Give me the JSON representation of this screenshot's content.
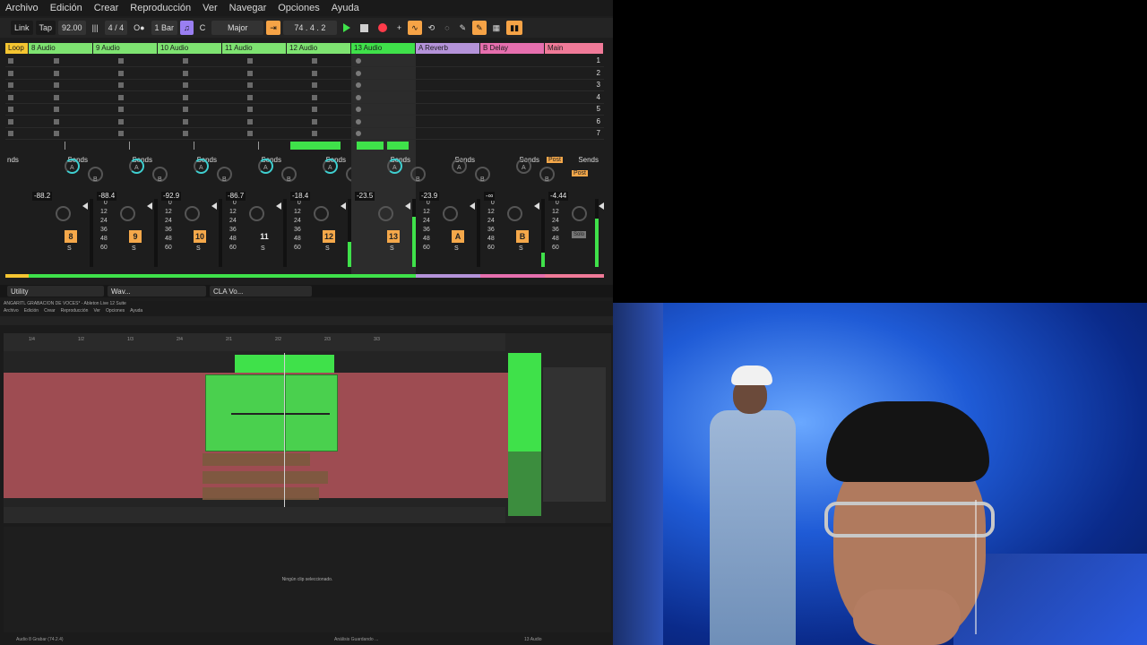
{
  "menu": [
    "Archivo",
    "Edición",
    "Crear",
    "Reproducción",
    "Ver",
    "Navegar",
    "Opciones",
    "Ayuda"
  ],
  "transport": {
    "link": "Link",
    "tap": "Tap",
    "tempo": "92.00",
    "signature": "4 / 4",
    "quantize": "1 Bar",
    "key": "C",
    "scale": "Major",
    "position": "74 .  4 .  2"
  },
  "tracks": [
    {
      "name": "Loop",
      "color": "#f5c531",
      "num": "",
      "vol": "",
      "numStyle": ""
    },
    {
      "name": "8 Audio",
      "color": "#7ee371",
      "num": "8",
      "vol": "-88.2",
      "numStyle": "orange"
    },
    {
      "name": "9 Audio",
      "color": "#7ee371",
      "num": "9",
      "vol": "-88.4",
      "numStyle": "orange"
    },
    {
      "name": "10 Audio",
      "color": "#7ee371",
      "num": "10",
      "vol": "-92.9",
      "numStyle": "orange"
    },
    {
      "name": "11 Audio",
      "color": "#7ee371",
      "num": "11",
      "vol": "-86.7",
      "numStyle": "plain"
    },
    {
      "name": "12 Audio",
      "color": "#7ee371",
      "num": "12",
      "vol": "-18.4",
      "numStyle": "orange"
    },
    {
      "name": "13 Audio",
      "color": "#3fe14a",
      "num": "13",
      "vol": "-23.5",
      "numStyle": "orange"
    },
    {
      "name": "A Reverb",
      "color": "#b493d9",
      "num": "A",
      "vol": "-23.9",
      "numStyle": "orange"
    },
    {
      "name": "B Delay",
      "color": "#e66fae",
      "num": "B",
      "vol": "-∞",
      "numStyle": "orange"
    },
    {
      "name": "Main",
      "color": "#f07a98",
      "num": "",
      "vol": "-4.44",
      "numStyle": ""
    }
  ],
  "sends_label": "Sends",
  "send_a": "A",
  "send_b": "B",
  "sends_partial": "nds",
  "s_button": "S",
  "post_label": "Post",
  "solo_label": "Solo",
  "scene_numbers": [
    "1",
    "2",
    "3",
    "4",
    "5",
    "6",
    "7"
  ],
  "meter_scale": [
    "0",
    "12",
    "24",
    "36",
    "48",
    "60"
  ],
  "devices": [
    "Utility",
    "Wav...",
    "CLA Vo..."
  ],
  "bottom": {
    "title": "ANGARITL GRABACION DE VOCES* - Ableton Live 12 Suite",
    "menu": [
      "Archivo",
      "Edición",
      "Crear",
      "Reproducción",
      "Ver",
      "Opciones",
      "Ayuda"
    ],
    "ruler_ticks": [
      "1/4",
      "1/2",
      "1/3",
      "2/4",
      "2/1",
      "2/2",
      "2/3",
      "3/3"
    ],
    "no_clip_text": "Ningún clip seleccionado.",
    "status": "Audio 8 Grabar (74.2.4)",
    "status_mid": "Análisis Guardando ...",
    "status_right": "13 Audio"
  }
}
